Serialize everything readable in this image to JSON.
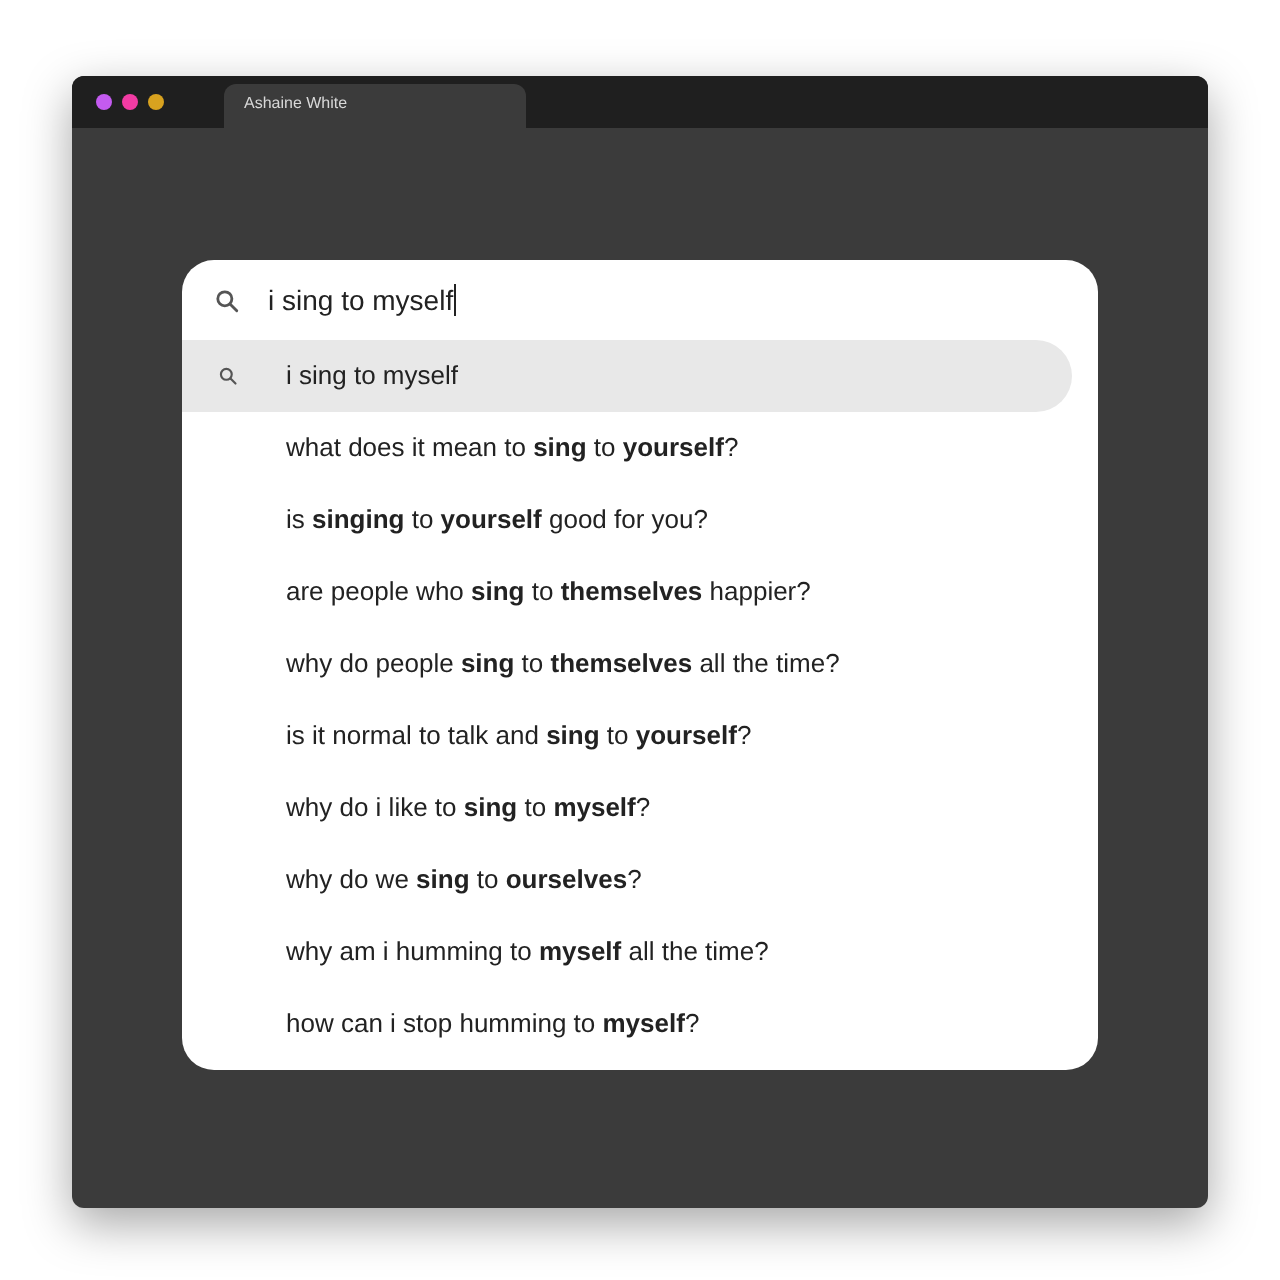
{
  "window": {
    "tab_title": "Ashaine White"
  },
  "search": {
    "value": "i sing to myself"
  },
  "suggestions": [
    {
      "text": "i sing to myself",
      "kind": "history",
      "selected": true
    },
    {
      "text": "what does it mean to **sing** to **yourself**?",
      "kind": "plain",
      "selected": false
    },
    {
      "text": "is **singing** to **yourself** good for you?",
      "kind": "plain",
      "selected": false
    },
    {
      "text": "are people who **sing** to **themselves** happier?",
      "kind": "plain",
      "selected": false
    },
    {
      "text": "why do people **sing** to **themselves** all the time?",
      "kind": "plain",
      "selected": false
    },
    {
      "text": "is it normal to talk and **sing** to **yourself**?",
      "kind": "plain",
      "selected": false
    },
    {
      "text": "why do i like to **sing** to **myself**?",
      "kind": "plain",
      "selected": false
    },
    {
      "text": "why do we **sing** to **ourselves**?",
      "kind": "plain",
      "selected": false
    },
    {
      "text": "why am i humming to **myself** all the time?",
      "kind": "plain",
      "selected": false
    },
    {
      "text": "how can i stop humming to **myself**?",
      "kind": "plain",
      "selected": false
    }
  ]
}
